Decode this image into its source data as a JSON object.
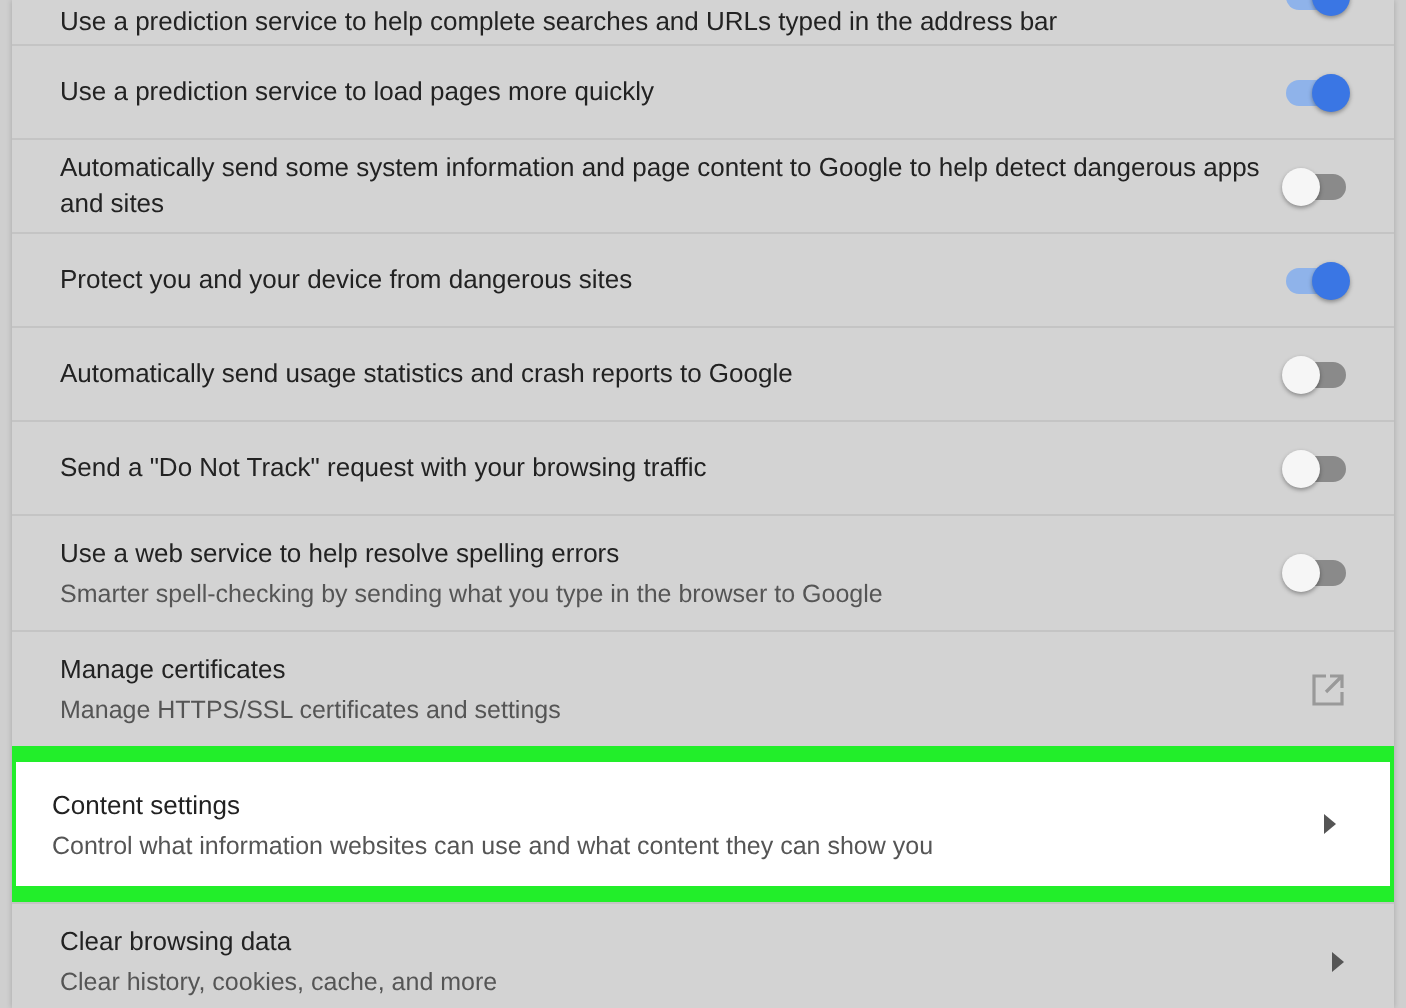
{
  "settings": [
    {
      "kind": "toggle",
      "title": "Use a prediction service to help complete searches and URLs typed in the address bar",
      "on": true,
      "highlighted": false
    },
    {
      "kind": "toggle",
      "title": "Use a prediction service to load pages more quickly",
      "on": true,
      "highlighted": false
    },
    {
      "kind": "toggle",
      "title": "Automatically send some system information and page content to Google to help detect dangerous apps and sites",
      "on": false,
      "highlighted": false
    },
    {
      "kind": "toggle",
      "title": "Protect you and your device from dangerous sites",
      "on": true,
      "highlighted": false
    },
    {
      "kind": "toggle",
      "title": "Automatically send usage statistics and crash reports to Google",
      "on": false,
      "highlighted": false
    },
    {
      "kind": "toggle",
      "title": "Send a \"Do Not Track\" request with your browsing traffic",
      "on": false,
      "highlighted": false
    },
    {
      "kind": "toggle",
      "title": "Use a web service to help resolve spelling errors",
      "subtitle": "Smarter spell-checking by sending what you type in the browser to Google",
      "on": false,
      "highlighted": false
    },
    {
      "kind": "external",
      "title": "Manage certificates",
      "subtitle": "Manage HTTPS/SSL certificates and settings",
      "highlighted": false
    },
    {
      "kind": "arrow",
      "title": "Content settings",
      "subtitle": "Control what information websites can use and what content they can show you",
      "highlighted": true
    },
    {
      "kind": "arrow",
      "title": "Clear browsing data",
      "subtitle": "Clear history, cookies, cache, and more",
      "highlighted": false
    }
  ]
}
